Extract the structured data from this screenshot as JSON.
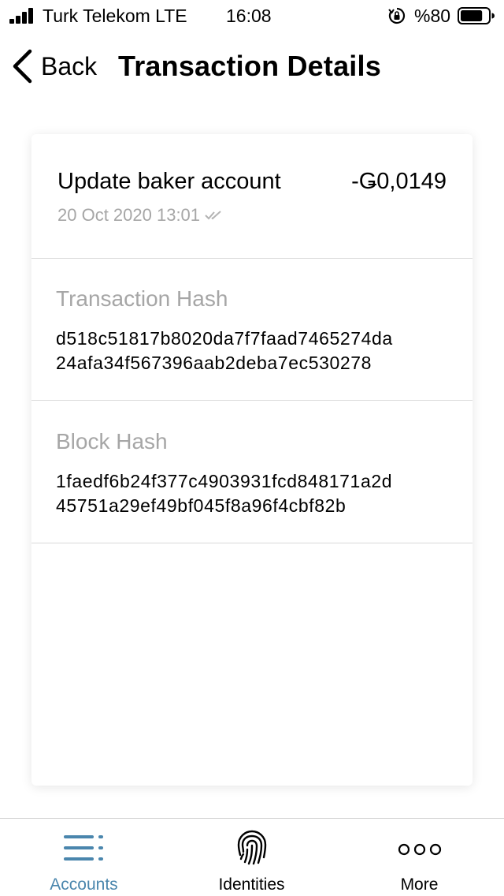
{
  "status_bar": {
    "carrier": "Turk Telekom  LTE",
    "time": "16:08",
    "battery_percent": "%80",
    "battery_level": 0.8,
    "signal_icon": "cellular-signal-icon",
    "rotation_icon": "rotation-lock-icon",
    "battery_icon": "battery-icon"
  },
  "nav": {
    "back_label": "Back",
    "title": "Transaction Details"
  },
  "transaction": {
    "type": "Update baker account",
    "amount": "-Ǥ0,0149",
    "date": "20 Oct 2020 13:01",
    "status_icon": "double-check-icon"
  },
  "sections": {
    "transaction_hash": {
      "label": "Transaction Hash",
      "line1": "d518c51817b8020da7f7faad7465274da",
      "line2": "24afa34f567396aab2deba7ec530278"
    },
    "block_hash": {
      "label": "Block Hash",
      "line1": "1faedf6b24f377c4903931fcd848171a2d",
      "line2": "45751a29ef49bf045f8a96f4cbf82b"
    }
  },
  "tab_bar": {
    "accounts": "Accounts",
    "identities": "Identities",
    "more": "More",
    "active_color": "#4a86ad"
  }
}
